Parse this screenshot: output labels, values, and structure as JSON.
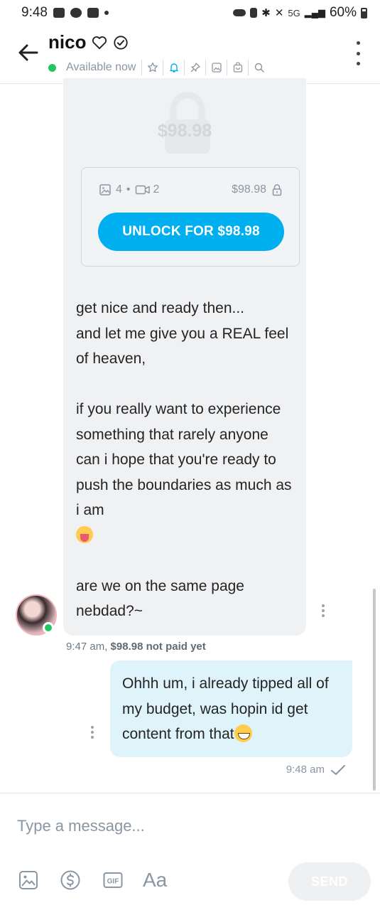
{
  "status_bar": {
    "time": "9:48",
    "network": "5G",
    "battery": "60%"
  },
  "header": {
    "contact_name": "nico",
    "status": "Available now",
    "icons": [
      "star-icon",
      "bell-icon",
      "pin-icon",
      "image-icon",
      "bag-icon",
      "search-icon"
    ]
  },
  "locked_post": {
    "price_overlay": "$98.98",
    "photos": "4",
    "videos": "2",
    "price": "$98.98",
    "unlock_label": "UNLOCK FOR $98.98"
  },
  "messages": {
    "incoming": {
      "text_part1": "get nice and ready then...\nand let me give you a REAL feel of heaven,\n\nif you really want to experience something that rarely anyone can i hope that you're ready to push the boundaries as much as i am\n",
      "text_part2": "\n\nare we on the same page nebdad?~",
      "time": "9:47 am,",
      "payment_status": "$98.98 not paid yet"
    },
    "outgoing": {
      "text": "Ohhh um, i already tipped all of my budget, was hopin id get content from that",
      "time": "9:48 am"
    }
  },
  "composer": {
    "placeholder": "Type a message...",
    "format_label": "Aa",
    "send_label": "SEND"
  },
  "colors": {
    "accent": "#00aff0",
    "online": "#24c55f",
    "incoming_bubble": "#f0f1f3",
    "outgoing_bubble": "#dff3fb"
  }
}
